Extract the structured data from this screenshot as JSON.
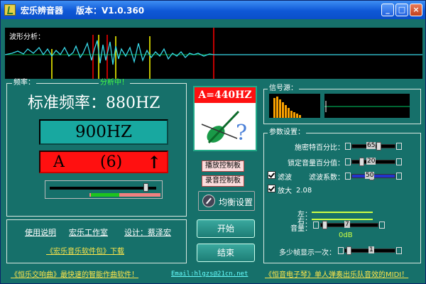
{
  "window": {
    "title": "宏乐辨音器",
    "version": "版本：V1.0.360"
  },
  "wave": {
    "label": "波形分析："
  },
  "freq": {
    "label": "频率：",
    "status": "分析中！",
    "standard": "标准频率：880HZ",
    "detected": "900HZ",
    "note": "A",
    "octave": "(6)",
    "arrow": "↑"
  },
  "logo": {
    "text": "A=440HZ"
  },
  "controls": {
    "play_panel": "播放控制板",
    "record_panel": "录音控制板",
    "eq_button": "均衡设置",
    "start": "开始",
    "stop": "结束"
  },
  "signal": {
    "label": "信号源："
  },
  "settings": {
    "label": "参数设置：",
    "rows": [
      {
        "name": "施密特百分比：",
        "value": "65"
      },
      {
        "name": "锁定音量百分值：",
        "value": "20"
      },
      {
        "name": "滤波系数：",
        "value": "50"
      }
    ],
    "filter_check": "滤波",
    "amp_check": "放大",
    "amp_value": "2.08",
    "left": "左：",
    "right": "右：",
    "volume": "音量：",
    "volume_value": "7",
    "db": "0dB",
    "frame_label": "多少帧显示一次：",
    "frame_value": "1"
  },
  "links": {
    "help": "使用说明",
    "studio": "宏乐工作室",
    "design": "设计：蔡泽宏",
    "pack": "《宏乐音乐软件包》下载"
  },
  "footer": {
    "left": "《恒乐交响曲》最快速的智能作曲软件！",
    "email": "Email:hlgzs@21cn.net",
    "right": "《恒音电子琴》单人弹奏出乐队音效的MIDI！"
  },
  "colors": {
    "bg": "#16706a",
    "lcd": "#18a8a0",
    "alert": "#ff1010",
    "link": "#ffe64a"
  }
}
